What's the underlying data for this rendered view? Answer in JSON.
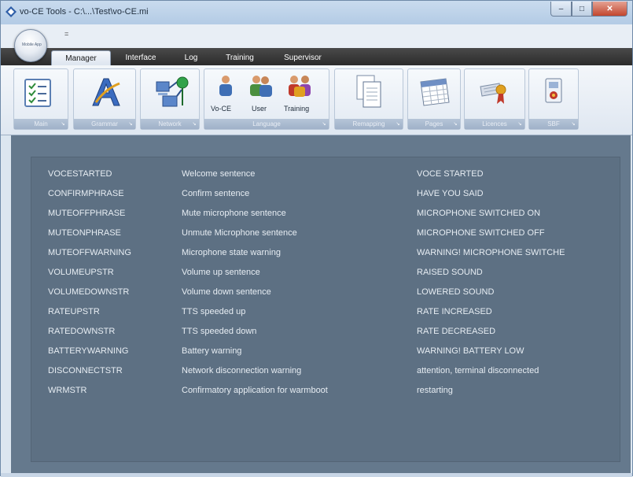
{
  "window": {
    "title": "vo-CE Tools - C:\\...\\Test\\vo-CE.mi",
    "close_glyph": "✕",
    "max_glyph": "□",
    "min_glyph": "–"
  },
  "orb_mark": "Mobile App",
  "qat_glyph": "=",
  "tabs": [
    "Manager",
    "Interface",
    "Log",
    "Training",
    "Supervisor"
  ],
  "ribbon_groups": [
    {
      "label": "Main",
      "icon": "checklist-icon"
    },
    {
      "label": "Grammar",
      "icon": "grammar-icon"
    },
    {
      "label": "Network",
      "icon": "network-icon"
    },
    {
      "label": "Language",
      "icon": "language-icon",
      "buttons": [
        "Vo-CE",
        "User",
        "Training"
      ]
    },
    {
      "label": "Remapping",
      "icon": "document-icon"
    },
    {
      "label": "Pages",
      "icon": "calendar-icon"
    },
    {
      "label": "Licences",
      "icon": "license-icon"
    },
    {
      "label": "SBF",
      "icon": "sbf-icon"
    }
  ],
  "launcher_glyph": "↘",
  "table": {
    "rows": [
      [
        "VOCESTARTED",
        "Welcome sentence",
        "VOCE STARTED"
      ],
      [
        "CONFIRMPHRASE",
        "Confirm sentence",
        "HAVE YOU SAID"
      ],
      [
        "MUTEOFFPHRASE",
        "Mute microphone sentence",
        "MICROPHONE SWITCHED ON"
      ],
      [
        "MUTEONPHRASE",
        "Unmute Microphone sentence",
        "MICROPHONE SWITCHED OFF"
      ],
      [
        "MUTEOFFWARNING",
        "Microphone state warning",
        "WARNING! MICROPHONE SWITCHE"
      ],
      [
        "VOLUMEUPSTR",
        "Volume up sentence",
        "RAISED SOUND"
      ],
      [
        "VOLUMEDOWNSTR",
        "Volume down sentence",
        "LOWERED SOUND"
      ],
      [
        "RATEUPSTR",
        "TTS speeded up",
        "RATE INCREASED"
      ],
      [
        "RATEDOWNSTR",
        "TTS speeded down",
        "RATE DECREASED"
      ],
      [
        "BATTERYWARNING",
        "Battery warning",
        "WARNING! BATTERY LOW"
      ],
      [
        "DISCONNECTSTR",
        "Network disconnection warning",
        "attention, terminal disconnected"
      ],
      [
        "WRMSTR",
        "Confirmatory application for warmboot",
        "restarting"
      ]
    ]
  },
  "colors": {
    "canvas": "#65798d",
    "panel": "#5d7083",
    "row_text": "#e7edf3"
  }
}
